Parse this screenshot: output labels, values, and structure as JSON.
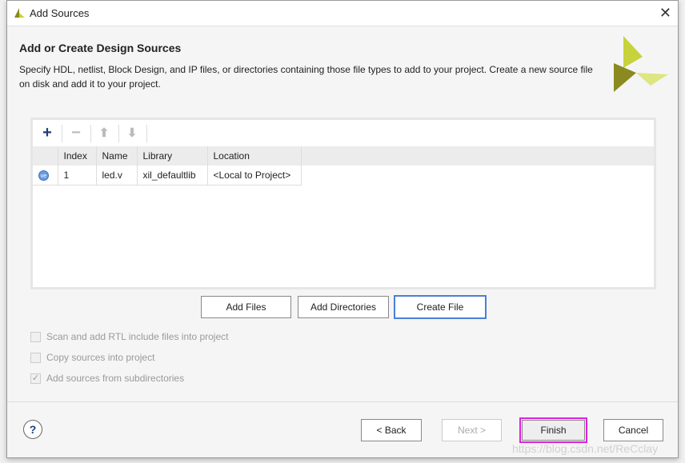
{
  "window": {
    "title": "Add Sources",
    "close_icon": "close-icon"
  },
  "header": {
    "title": "Add or Create Design Sources",
    "description": "Specify HDL, netlist, Block Design, and IP files, or directories containing those file types to add to your project. Create a new source file on disk and add it to your project."
  },
  "toolbar": {
    "icons": [
      "plus-icon",
      "minus-icon",
      "arrow-up-icon",
      "arrow-down-icon"
    ]
  },
  "table": {
    "columns": [
      "Index",
      "Name",
      "Library",
      "Location"
    ],
    "rows": [
      {
        "icon": "verilog-file-icon",
        "icon_text": "ve",
        "index": "1",
        "name": "led.v",
        "library": "xil_defaultlib",
        "location": "<Local to Project>"
      }
    ]
  },
  "actions": {
    "add_files": "Add Files",
    "add_directories": "Add Directories",
    "create_file": "Create File"
  },
  "options": [
    {
      "label": "Scan and add RTL include files into project",
      "checked": false,
      "enabled": false
    },
    {
      "label": "Copy sources into project",
      "checked": false,
      "enabled": false
    },
    {
      "label": "Add sources from subdirectories",
      "checked": true,
      "enabled": false
    }
  ],
  "footer": {
    "help": "?",
    "back": "< Back",
    "next": "Next >",
    "finish": "Finish",
    "cancel": "Cancel"
  },
  "colors": {
    "accent": "#4a7fd8",
    "highlight": "#e020e0",
    "logo": "#c8d23c"
  },
  "watermark": "https://blog.csdn.net/ReCclay"
}
